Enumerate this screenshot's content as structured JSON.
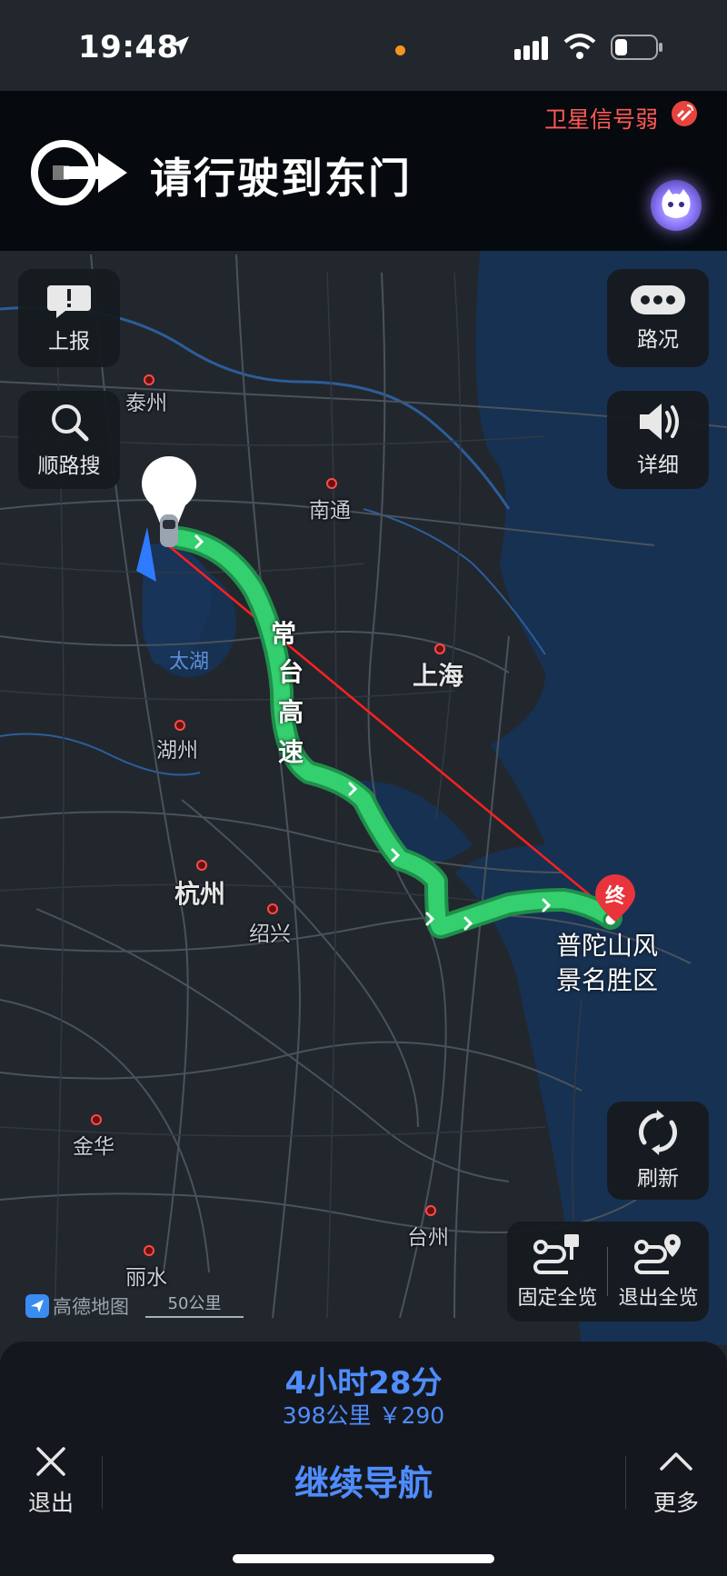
{
  "status_bar": {
    "time": "19:48",
    "icons": [
      "location-arrow-icon",
      "signal-icon",
      "wifi-icon",
      "battery-icon"
    ]
  },
  "nav": {
    "satellite_status": "卫星信号弱",
    "instruction": "请行驶到东门",
    "turn_icon": "turn-right-arrow-icon"
  },
  "left_controls": {
    "report_label": "上报",
    "search_along_label": "顺路搜"
  },
  "right_controls": {
    "traffic_label": "路况",
    "voice_label": "详细",
    "refresh_label": "刷新",
    "fix_overview_label": "固定全览",
    "exit_overview_label": "退出全览"
  },
  "map": {
    "cities": {
      "taizhou_js": "泰州",
      "nantong": "南通",
      "shanghai": "上海",
      "huzhou": "湖州",
      "hangzhou": "杭州",
      "shaoxing": "绍兴",
      "jinhua": "金华",
      "taizhou_zj": "台州",
      "lishui": "丽水"
    },
    "lake": "太湖",
    "road_name": [
      "常",
      "台",
      "高",
      "速"
    ],
    "destination_marker": "终",
    "destination_line1": "普陀山风",
    "destination_line2": "景名胜区",
    "brand": "高德地图",
    "scale": "50公里",
    "colors": {
      "route": "#22c25d",
      "straight_line": "#ff2020",
      "water": "#173152",
      "land": "#22272e"
    }
  },
  "bottom": {
    "eta": "4小时28分",
    "trip_info": "398公里 ￥290",
    "exit_label": "退出",
    "continue_label": "继续导航",
    "more_label": "更多"
  }
}
